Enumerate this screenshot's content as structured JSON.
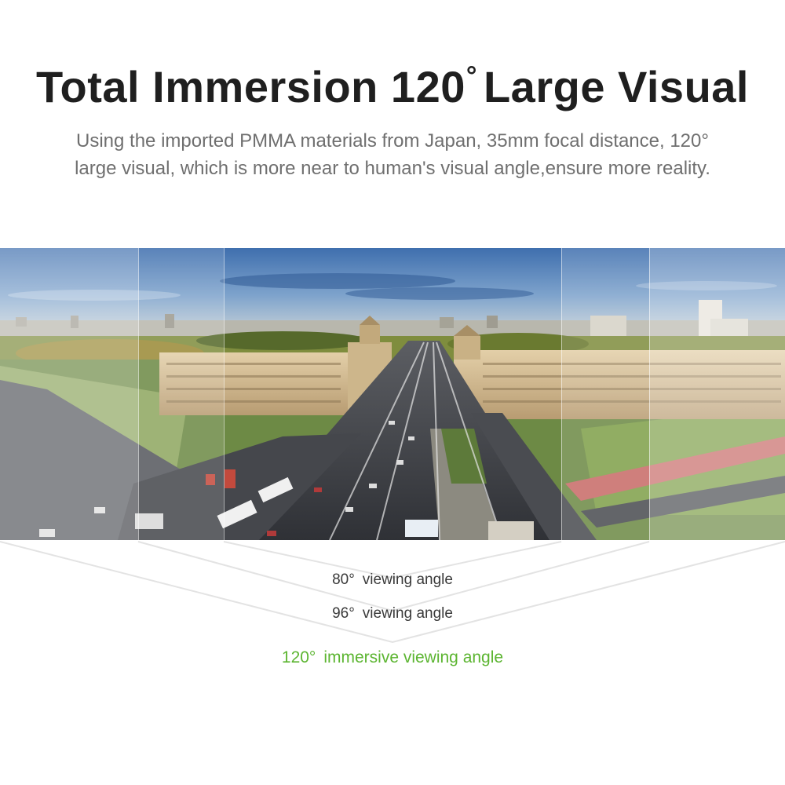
{
  "headline": {
    "prefix": "Total Immersion 120",
    "degree": "°",
    "suffix": "Large Visual"
  },
  "description": {
    "line1": "Using the imported PMMA materials from Japan, 35mm focal distance, 120°",
    "line2": "large visual, which is more near to human's visual angle,ensure more reality."
  },
  "angles": [
    {
      "value": "80°",
      "text": "viewing angle"
    },
    {
      "value": "96°",
      "text": "viewing angle"
    },
    {
      "value": "120°",
      "text": "immersive viewing angle"
    }
  ],
  "colors": {
    "headline": "#1f1f1f",
    "description": "#6f6f6f",
    "angle_text": "#3a3a3a",
    "accent_green": "#5cb531",
    "sky": "#4f7fb6",
    "road": "#3d3f44"
  }
}
